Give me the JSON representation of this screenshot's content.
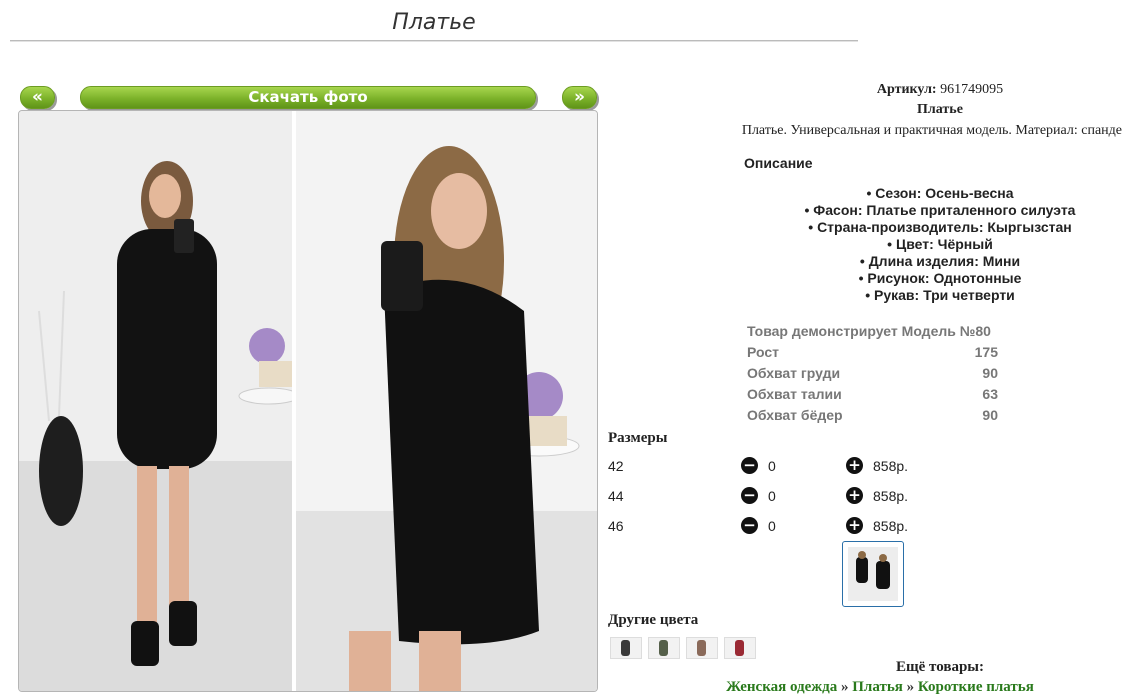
{
  "page": {
    "title": "Платье"
  },
  "gallery": {
    "prev_label": "«",
    "next_label": "»",
    "download_label": "Скачать фото"
  },
  "product": {
    "article_label": "Артикул:",
    "article_value": "961749095",
    "name": "Платье",
    "short_desc": "Платье. Универсальная и практичная модель. Материал: спандекс.",
    "desc_heading": "Описание",
    "features": [
      "• Сезон: Осень-весна",
      "• Фасон: Платье приталенного силуэта",
      "• Страна-производитель: Кыргызстан",
      "• Цвет: Чёрный",
      "• Длина изделия: Мини",
      "• Рисунок: Однотонные",
      "• Рукав: Три четверти"
    ]
  },
  "model": {
    "heading": "Товар демонстрирует Модель №80",
    "rows": [
      {
        "label": "Рост",
        "value": "175"
      },
      {
        "label": "Обхват груди",
        "value": "90"
      },
      {
        "label": "Обхват талии",
        "value": "63"
      },
      {
        "label": "Обхват бёдер",
        "value": "90"
      }
    ]
  },
  "sizes": {
    "heading": "Размеры",
    "rows": [
      {
        "size": "42",
        "qty": "0",
        "price": "858р."
      },
      {
        "size": "44",
        "qty": "0",
        "price": "858р."
      },
      {
        "size": "46",
        "qty": "0",
        "price": "858р."
      }
    ],
    "minus_glyph": "−",
    "plus_glyph": "+"
  },
  "other_colors": {
    "heading": "Другие цвета",
    "swatches": [
      {
        "color": "#3a3a3a"
      },
      {
        "color": "#55604a"
      },
      {
        "color": "#8a6a5a"
      },
      {
        "color": "#9a2a34"
      }
    ]
  },
  "more": {
    "heading": "Ещё товары:",
    "crumbs": [
      "Женская одежда",
      "Платья",
      "Короткие платья"
    ],
    "separator": "»"
  },
  "colors": {
    "button_green": "#7cb22a",
    "link_green": "#2a7a1c",
    "thumb_border": "#2a6fa8"
  }
}
